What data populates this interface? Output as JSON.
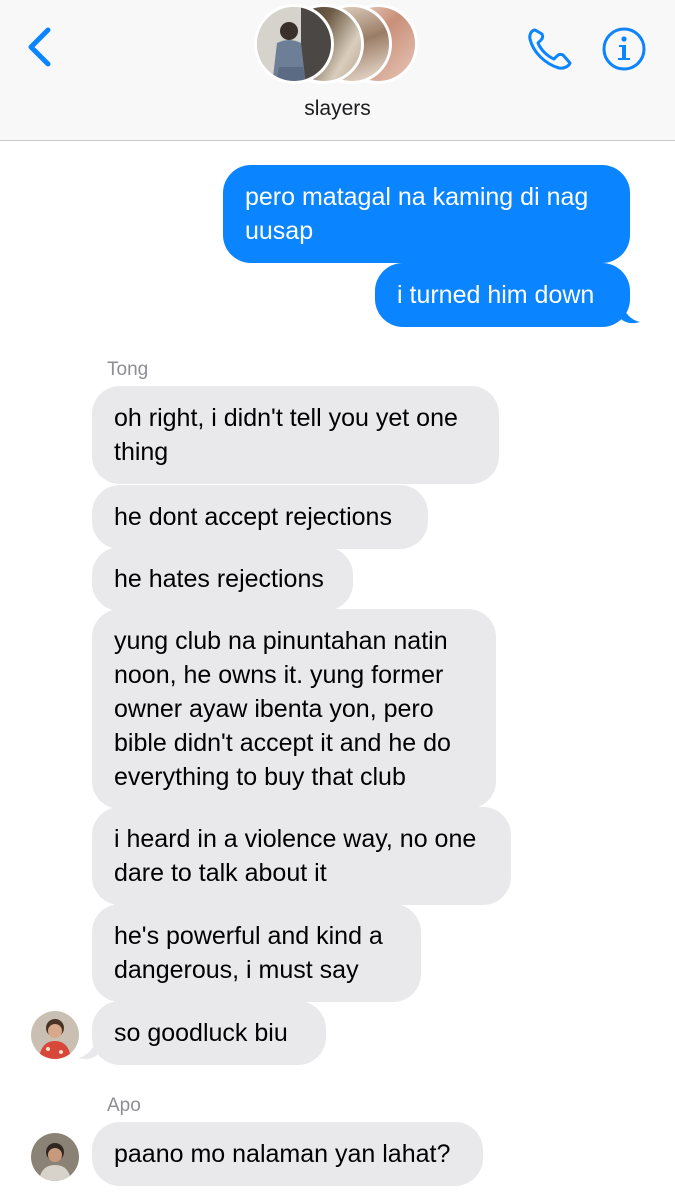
{
  "header": {
    "title": "slayers",
    "colors": {
      "accent": "#0a84ff",
      "header_bg": "#f8f8f8"
    },
    "icons": [
      "chevron-left-icon",
      "phone-icon",
      "info-icon"
    ]
  },
  "messages": {
    "outgoing": [
      "pero matagal na kaming di nag\nuusap",
      "i turned him down"
    ],
    "tong": {
      "sender": "Tong",
      "bubbles": [
        "oh right, i didn't tell you yet one\nthing",
        "he dont accept rejections",
        "he hates rejections",
        "yung club na pinuntahan natin\nnoon, he owns it. yung former\nowner ayaw ibenta yon, pero\nbible didn't accept it and he do\neverything to buy that club",
        "i heard in a violence way, no one\ndare to talk about it",
        "he's powerful and kind a\ndangerous, i must say",
        "so goodluck biu"
      ]
    },
    "apo": {
      "sender": "Apo",
      "bubbles": [
        "paano mo nalaman yan lahat?"
      ]
    }
  },
  "colors": {
    "outgoing_bubble": "#0a84ff",
    "incoming_bubble": "#e9e9eb",
    "sender_label": "#8e8e93"
  }
}
